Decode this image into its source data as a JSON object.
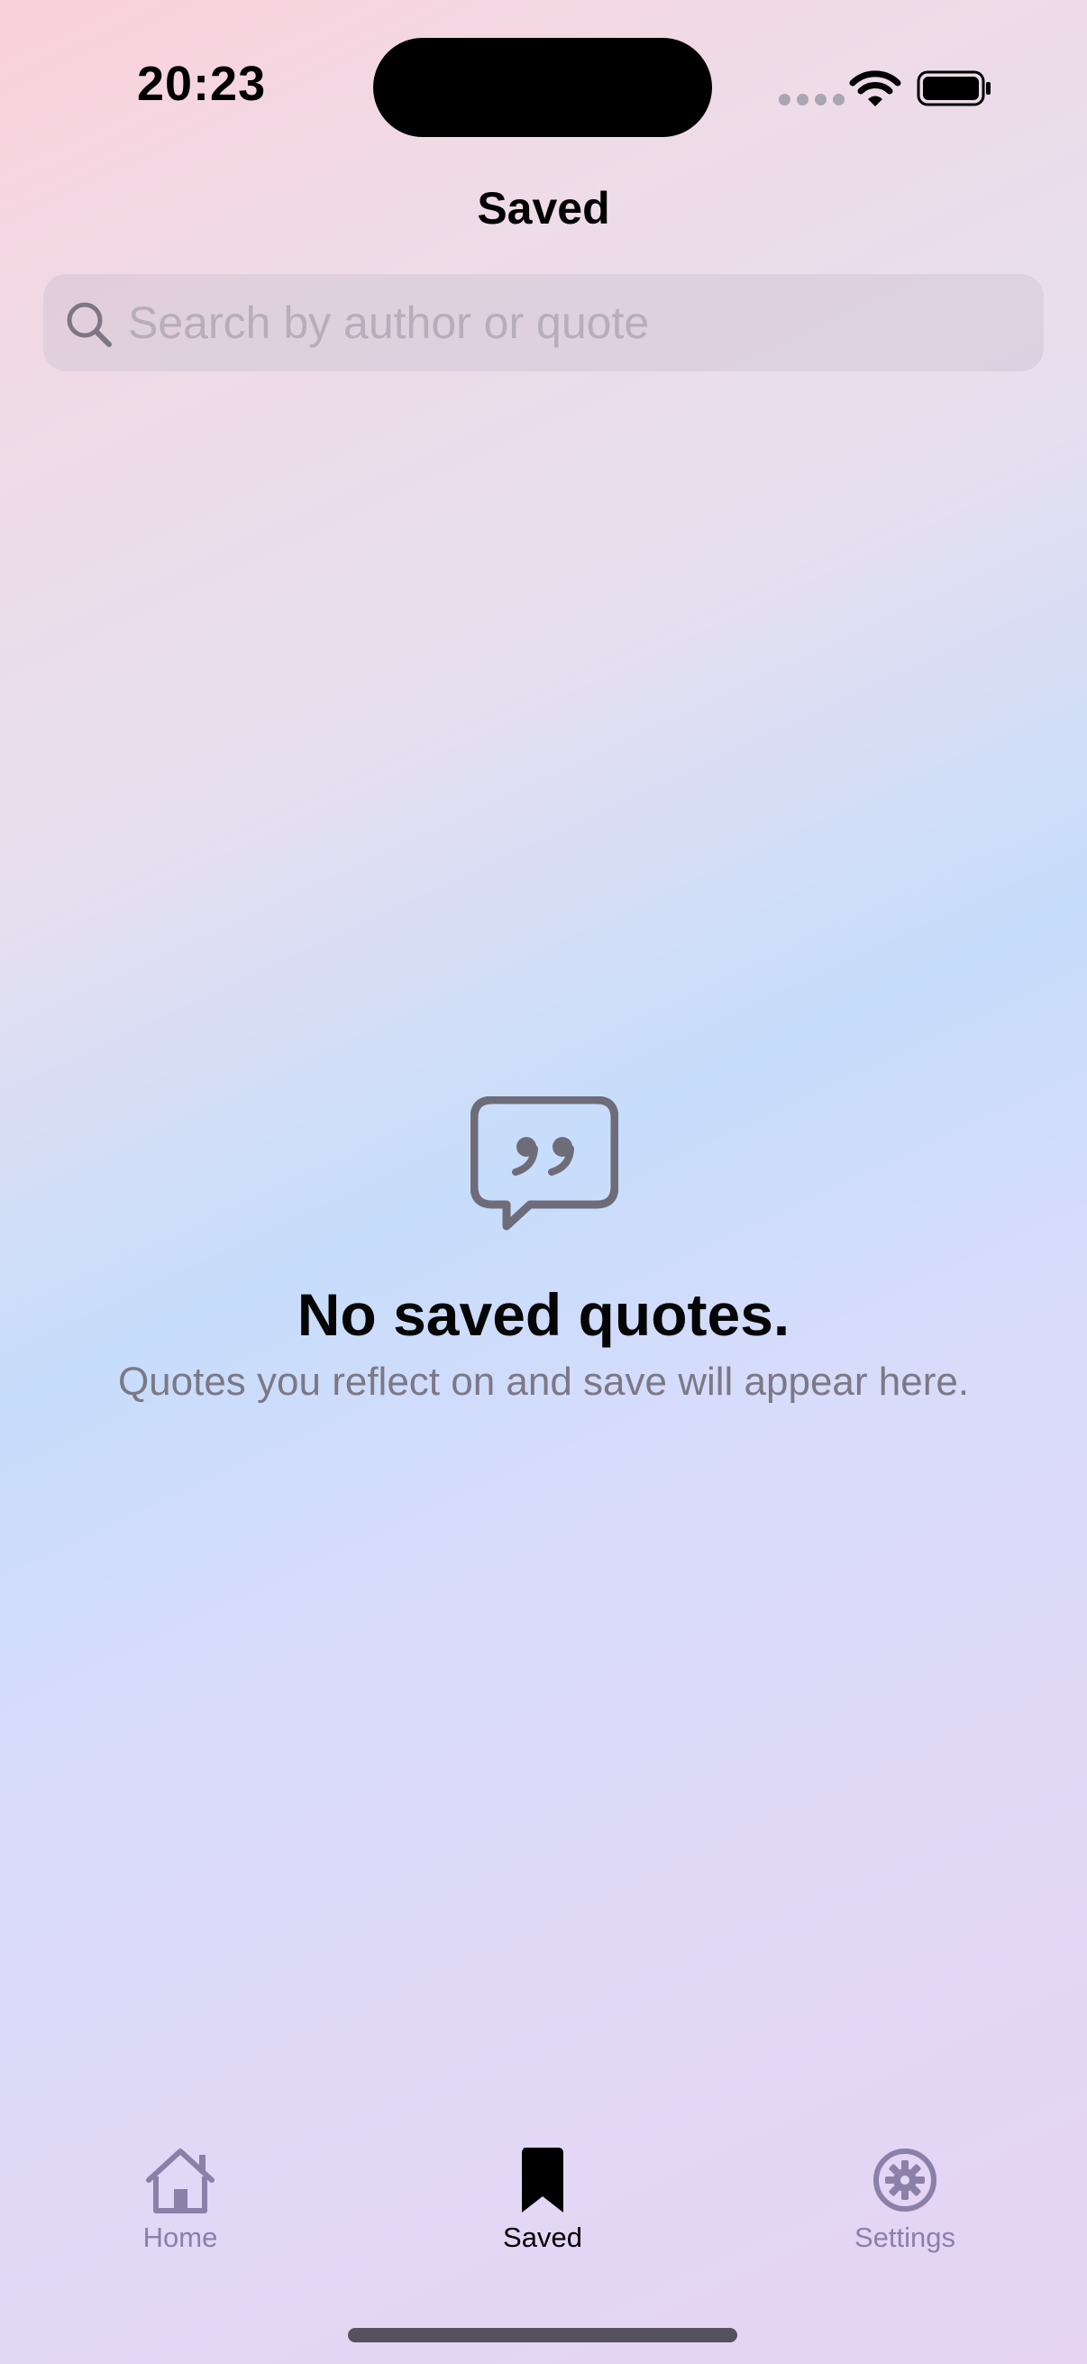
{
  "status_bar": {
    "time": "20:23",
    "icons": [
      "cellular-dots-icon",
      "wifi-icon",
      "battery-icon"
    ]
  },
  "nav": {
    "title": "Saved"
  },
  "search": {
    "placeholder": "Search by author or quote",
    "value": "",
    "icon": "search-icon"
  },
  "empty_state": {
    "icon": "quote-bubble-icon",
    "title": "No saved quotes.",
    "subtitle": "Quotes you reflect on and save will appear here."
  },
  "tab_bar": {
    "selected": "Saved",
    "tabs": [
      {
        "label": "Home",
        "icon": "house-icon"
      },
      {
        "label": "Saved",
        "icon": "bookmark-icon"
      },
      {
        "label": "Settings",
        "icon": "gear-icon"
      }
    ]
  },
  "colors": {
    "tab_inactive": "#8a80a8",
    "tab_active": "#000000",
    "empty_icon": "#6e6c78"
  }
}
